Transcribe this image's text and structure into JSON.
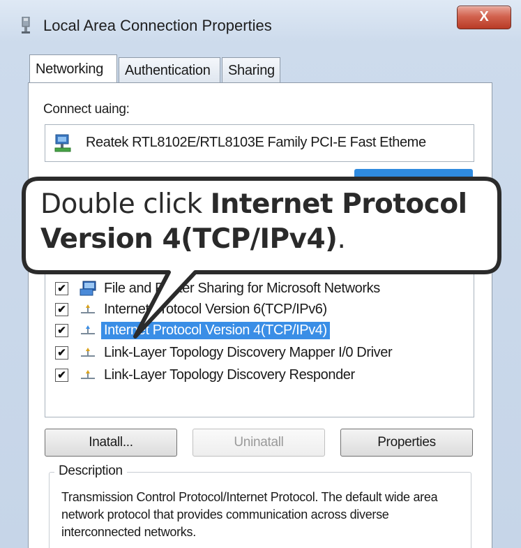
{
  "window": {
    "title": "Local Area Connection Properties",
    "close_label": "X",
    "title_icon": "network-adapter-icon"
  },
  "tabs": [
    {
      "label": "Networking",
      "active": true
    },
    {
      "label": "Authentication",
      "active": false
    },
    {
      "label": "Sharing",
      "active": false
    }
  ],
  "networking": {
    "connect_using_label": "Connect uaing:",
    "adapter_name": "Reatek RTL8102E/RTL8103E Family PCI-E Fast Etheme",
    "adapter_icon": "network-card-icon",
    "items": [
      {
        "label": "File and Printer Sharing for Microsoft Networks",
        "checked": true,
        "icon": "file-sharing-icon",
        "selected": false
      },
      {
        "label": "Internet Protocol Version 6(TCP/IPv6)",
        "checked": true,
        "icon": "protocol-icon",
        "selected": false
      },
      {
        "label": "Internet Protocol Version 4(TCP/IPv4)",
        "checked": true,
        "icon": "protocol-icon",
        "selected": true
      },
      {
        "label": "Link-Layer Topology Discovery Mapper I/0 Driver",
        "checked": true,
        "icon": "protocol-icon",
        "selected": false
      },
      {
        "label": "Link-Layer Topology Discovery Responder",
        "checked": true,
        "icon": "protocol-icon",
        "selected": false
      }
    ],
    "buttons": {
      "install": "Inatall...",
      "uninstall": "Uninatall",
      "properties": "Properties"
    },
    "description": {
      "legend": "Description",
      "text": "Transmission Control Protocol/Internet Protocol. The default wide area network protocol that provides communication across diverse interconnected networks."
    }
  },
  "callout": {
    "prefix": "Double click ",
    "bold_line1": "Internet Protocol",
    "bold_line2": "Version 4(TCP/IPv4)",
    "suffix": "."
  },
  "colors": {
    "selection": "#3a8ee6",
    "close_button": "#c7462f",
    "window_frame": "#cddbec"
  }
}
